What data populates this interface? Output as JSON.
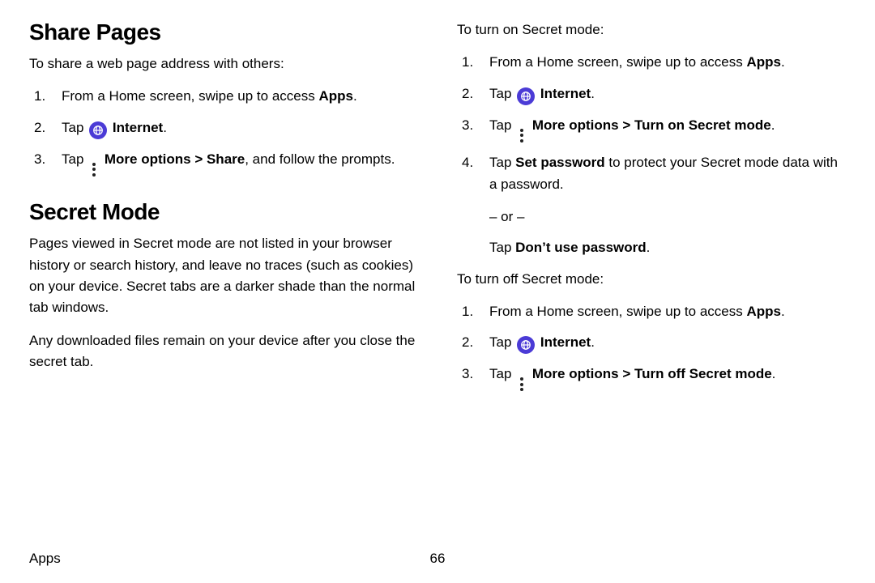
{
  "left": {
    "h_share": "Share Pages",
    "share_intro": "To share a web page address with others:",
    "share_li1_a": "From a Home screen, swipe up to access ",
    "share_li1_b": "Apps",
    "share_li1_c": ".",
    "tap": "Tap ",
    "internet": "Internet",
    "period": ".",
    "share_li3_a": "Tap ",
    "more_options": "More options",
    "share_li3_b": " > ",
    "share_label": "Share",
    "share_li3_c": ", and follow the prompts.",
    "h_secret": "Secret Mode",
    "secret_p1": "Pages viewed in Secret mode are not listed in your browser history or search history, and leave no traces (such as cookies) on your device. Secret tabs are a darker shade than the normal tab windows.",
    "secret_p2": "Any downloaded files remain on your device after you close the secret tab."
  },
  "right": {
    "turn_on_intro": "To turn on Secret mode:",
    "li1_a": "From a Home screen, swipe up to access ",
    "li1_b": "Apps",
    "li1_c": ".",
    "tap": "Tap ",
    "internet": "Internet",
    "period": ".",
    "more_options": "More options",
    "gt": " > ",
    "turn_on_label": "Turn on Secret mode",
    "li4_a": "Tap ",
    "set_password": "Set password",
    "li4_b": " to protect your Secret mode data with a password.",
    "or": "– or –",
    "dont_use_a": "Tap ",
    "dont_use_b": "Don’t use password",
    "dont_use_c": ".",
    "turn_off_intro": "To turn off Secret mode:",
    "turn_off_label": "Turn off Secret mode"
  },
  "footer": {
    "section": "Apps",
    "page": "66"
  }
}
